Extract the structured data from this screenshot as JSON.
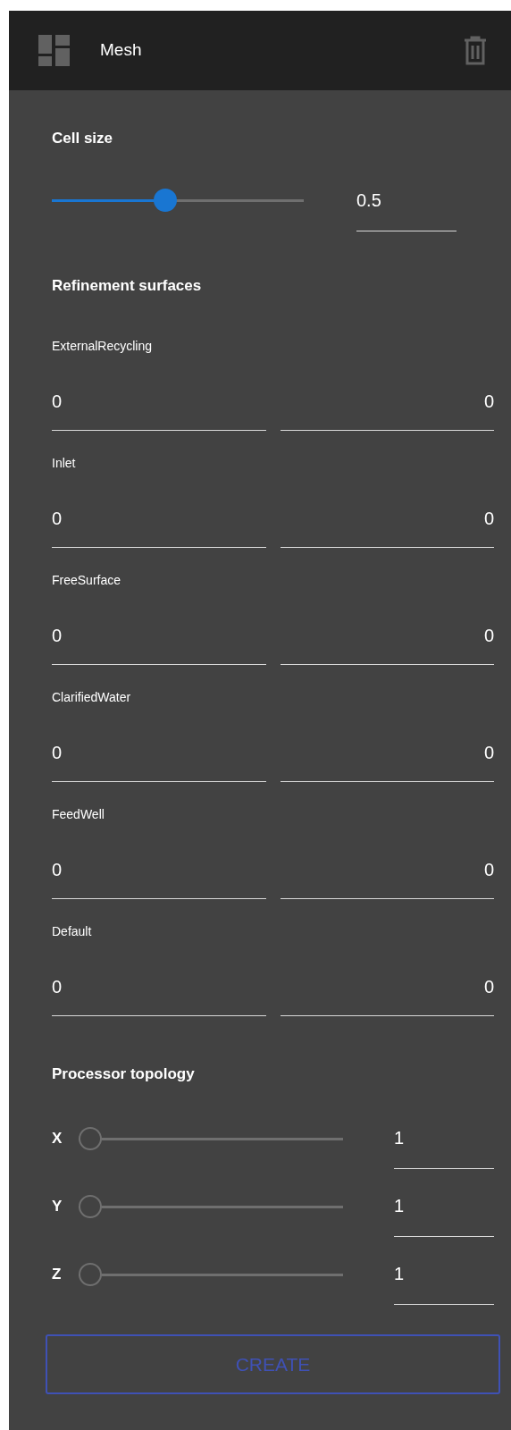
{
  "header": {
    "title": "Mesh"
  },
  "cell_size": {
    "title": "Cell size",
    "level": 0.45,
    "value": "0.5"
  },
  "refinement": {
    "title": "Refinement surfaces",
    "surfaces": [
      {
        "name": "ExternalRecycling",
        "min": "0",
        "max": "0"
      },
      {
        "name": "Inlet",
        "min": "0",
        "max": "0"
      },
      {
        "name": "FreeSurface",
        "min": "0",
        "max": "0"
      },
      {
        "name": "ClarifiedWater",
        "min": "0",
        "max": "0"
      },
      {
        "name": "FeedWell",
        "min": "0",
        "max": "0"
      },
      {
        "name": "Default",
        "min": "0",
        "max": "0"
      }
    ]
  },
  "topology": {
    "title": "Processor topology",
    "axes": [
      {
        "label": "X",
        "level": 0,
        "value": "1"
      },
      {
        "label": "Y",
        "level": 0,
        "value": "1"
      },
      {
        "label": "Z",
        "level": 0,
        "value": "1"
      }
    ]
  },
  "create_button": {
    "label": "CREATE"
  }
}
